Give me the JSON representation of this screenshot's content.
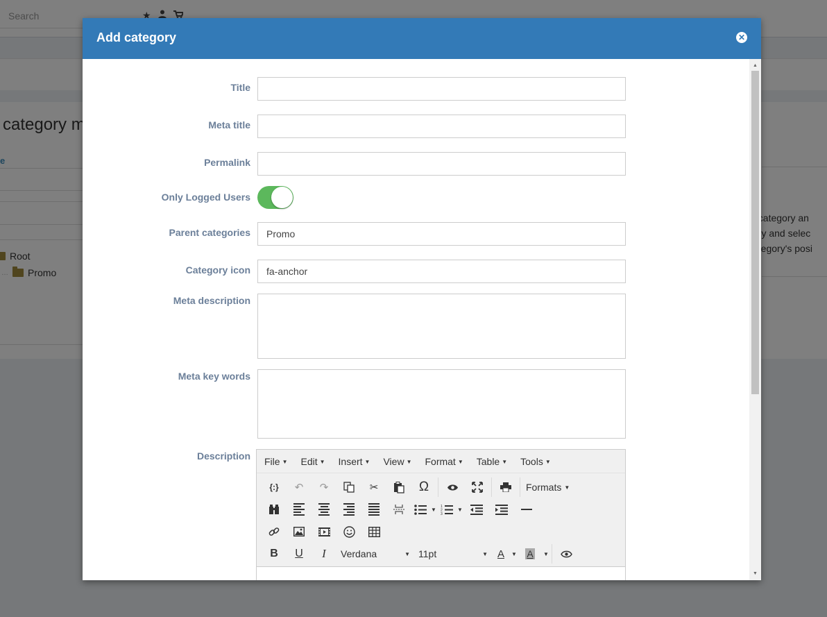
{
  "background": {
    "search_placeholder": "Search",
    "heading": "category m",
    "column_label": "e",
    "tree": [
      "Root",
      "Promo"
    ],
    "right_text": [
      "t category an",
      "ory and selec",
      "ategory's posi"
    ]
  },
  "modal": {
    "title": "Add category",
    "fields": {
      "title_label": "Title",
      "title_value": "",
      "meta_title_label": "Meta title",
      "meta_title_value": "",
      "permalink_label": "Permalink",
      "permalink_value": "",
      "only_logged_label": "Only Logged Users",
      "only_logged_on": true,
      "parent_categories_label": "Parent categories",
      "parent_categories_value": "Promo",
      "category_icon_label": "Category icon",
      "category_icon_value": "fa-anchor",
      "meta_description_label": "Meta description",
      "meta_key_words_label": "Meta key words",
      "description_label": "Description"
    },
    "editor": {
      "menus": [
        "File",
        "Edit",
        "Insert",
        "View",
        "Format",
        "Table",
        "Tools"
      ],
      "formats_label": "Formats",
      "font_family": "Verdana",
      "font_size": "11pt"
    }
  },
  "colors": {
    "header": "#337ab7",
    "toggle_on": "#5cb85c",
    "label": "#6b7f99"
  }
}
